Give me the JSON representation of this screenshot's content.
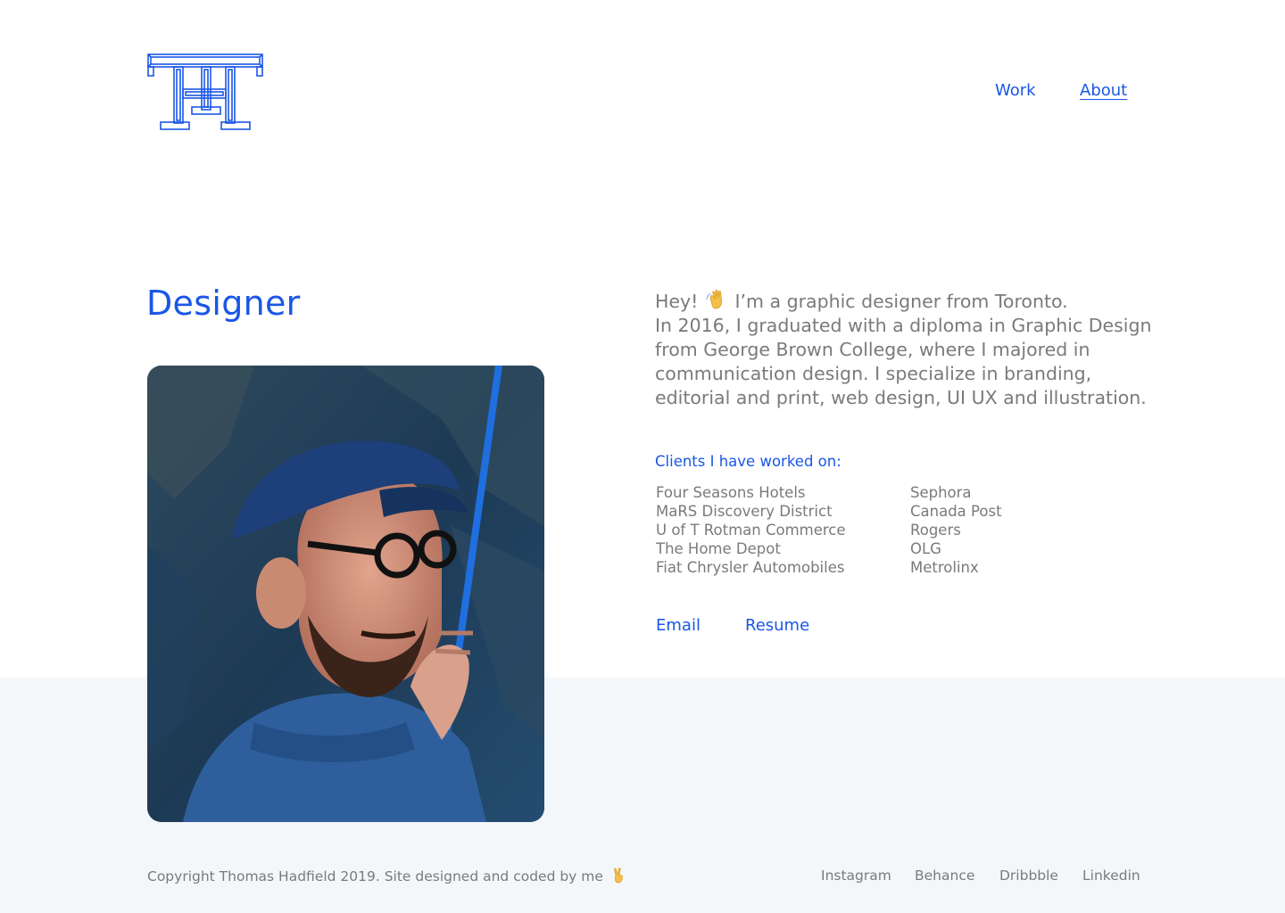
{
  "nav": {
    "work_label": "Work",
    "about_label": "About"
  },
  "page": {
    "title": "Designer"
  },
  "intro": {
    "greeting": "Hey!",
    "line1_rest": "I’m a graphic designer from Toronto.",
    "paragraph": "In 2016, I graduated with a diploma in Graphic Design from George Brown College, where I majored in communication design. I specialize in branding, editorial and print, web design, UI UX and illustration.",
    "emoji": "waving-hand"
  },
  "clients": {
    "heading": "Clients I have worked on:",
    "left": [
      "Four Seasons Hotels",
      "MaRS Discovery District",
      "U of T Rotman Commerce",
      "The Home Depot",
      "Fiat Chrysler Automobiles"
    ],
    "right": [
      "Sephora",
      "Canada Post",
      "Rogers",
      "OLG",
      "Metrolinx"
    ]
  },
  "contact": {
    "email_label": "Email",
    "resume_label": "Resume"
  },
  "footer": {
    "copyright": "Copyright Thomas Hadfield 2019. Site designed and coded by me",
    "emoji": "victory-hand",
    "social": [
      "Instagram",
      "Behance",
      "Dribbble",
      "Linkedin"
    ]
  },
  "colors": {
    "accent": "#1a56e6",
    "text": "#7a7a7a",
    "footer_bg": "#f4f7fa"
  }
}
